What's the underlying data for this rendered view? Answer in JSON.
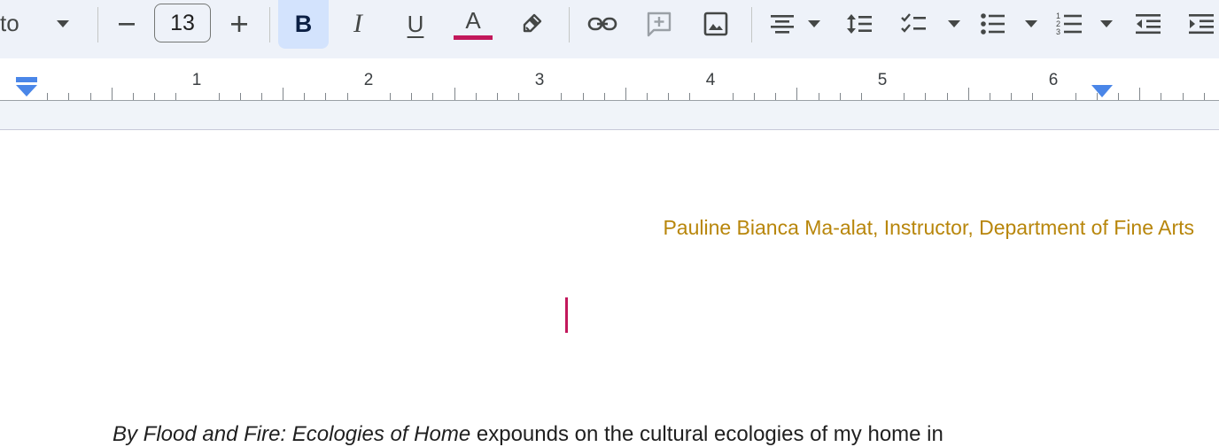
{
  "toolbar": {
    "font_name": "to",
    "font_size": "13",
    "font_menu_icon": "caret-down-icon",
    "decrease_icon": "minus-icon",
    "increase_icon": "plus-icon",
    "bold_label": "B",
    "italic_label": "I",
    "underline_label": "U",
    "text_color_label": "A",
    "text_color": "#c2185b",
    "highlight_icon": "pencil-icon",
    "link_icon": "link-icon",
    "comment_icon": "add-comment-icon",
    "image_icon": "image-icon",
    "align_icon": "align-center-icon",
    "line_spacing_icon": "line-spacing-icon",
    "checklist_icon": "checklist-icon",
    "bullet_list_icon": "bulleted-list-icon",
    "numbered_list_icon": "numbered-list-icon",
    "decrease_indent_icon": "decrease-indent-icon",
    "increase_indent_icon": "increase-indent-icon"
  },
  "ruler": {
    "numbers": [
      "1",
      "2",
      "3",
      "4",
      "5",
      "6"
    ]
  },
  "document": {
    "author_line": "Pauline Bianca Ma-alat, Instructor, Department of Fine Arts",
    "author_color": "#b8860b",
    "body_italic": "By Flood and Fire: Ecologies of Home",
    "body_rest": " expounds on the cultural ecologies of my home in"
  }
}
